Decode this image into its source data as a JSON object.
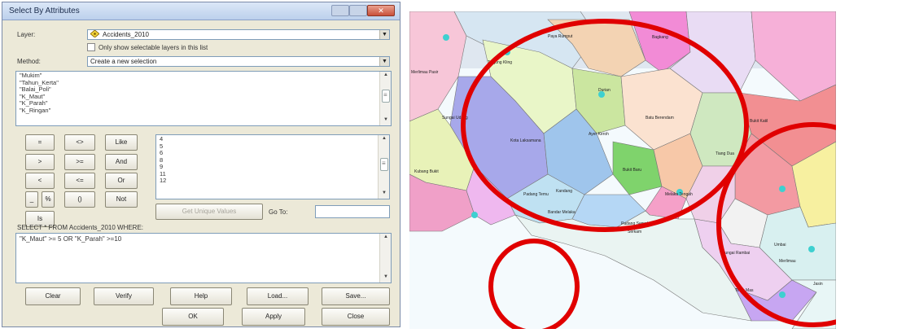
{
  "dialog": {
    "title": "Select By Attributes",
    "layer_label": "Layer:",
    "layer_value": "Accidents_2010",
    "only_selectable_label": "Only show selectable layers in this list",
    "method_label": "Method:",
    "method_value": "Create a new selection",
    "fields": [
      "\"Mukim\"",
      "\"Tahun_Kerta\"",
      "\"Balai_Poli\"",
      "\"K_Maut\"",
      "\"K_Parah\"",
      "\"K_Ringan\""
    ],
    "operators": {
      "eq": "=",
      "ne": "<>",
      "like": "Like",
      "gt": ">",
      "ge": ">=",
      "and": "And",
      "lt": "<",
      "le": "<=",
      "or": "Or",
      "underscore": "_",
      "percent": "%",
      "parens": "()",
      "not": "Not",
      "is": "Is"
    },
    "values": [
      "4",
      "5",
      "6",
      "8",
      "9",
      "11",
      "12"
    ],
    "get_unique_values": "Get Unique Values",
    "go_to_label": "Go To:",
    "select_statement": "SELECT * FROM Accidents_2010 WHERE:",
    "expression": "\"K_Maut\" >= 5 OR \"K_Parah\" >=10",
    "buttons": {
      "clear": "Clear",
      "verify": "Verify",
      "help": "Help",
      "load": "Load...",
      "save": "Save..."
    },
    "footer": {
      "ok": "OK",
      "apply": "Apply",
      "close": "Close"
    }
  },
  "map": {
    "labels": {
      "paya_rumput": "Paya Rumput",
      "bagkang": "Bagkang",
      "tanjung_kling": "Tanjung Kling",
      "merlimau_pasir": "Merlimau Pasir",
      "durian": "Durian",
      "batu_berendam": "Batu Berendam",
      "sungai_udang": "Sungai Udang",
      "bukit_katil": "Bukit Katil",
      "ayer_keroh": "Ayer Keroh",
      "kota_laksamana": "Kota Laksamana",
      "tiang_dua": "Tiang Dua",
      "kubang_bukit": "Kubang Bukit",
      "bukit_baru": "Bukit Baru",
      "kandang": "Kandang",
      "padang_temu": "Padang Temu",
      "melaka_tengah": "Melaka Tengah",
      "bandar_melaka": "Bandar Melaka",
      "padang_semabok": "Padang Semabok",
      "serkam": "Serkam",
      "umbai": "Umbai",
      "sungai_rambai": "Sungai Rambai",
      "merlimau": "Merlimau",
      "telok_mas": "Telok Mas",
      "jasin": "Jasin"
    },
    "highlight_color": "#e00000"
  }
}
